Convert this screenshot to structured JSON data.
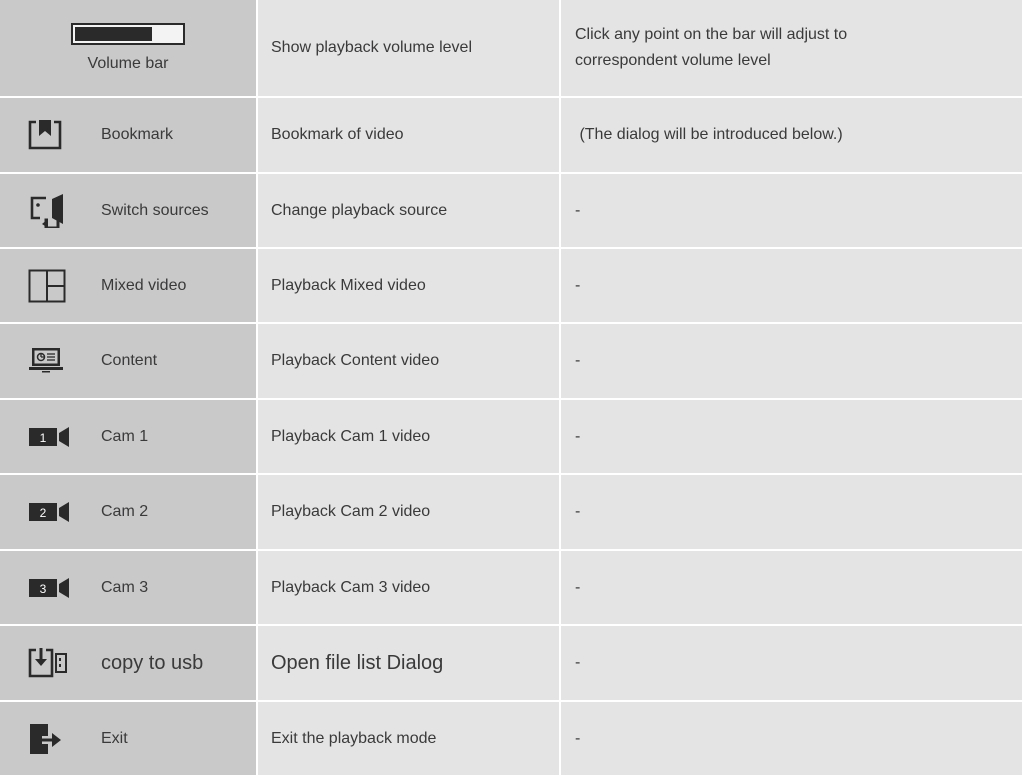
{
  "rows": [
    {
      "label": "Volume bar",
      "description": "Show playback volume level",
      "note": "Click any point on the bar will adjust to correspondent volume level",
      "volume_level": 0.73,
      "icon": "volume-bar-icon"
    },
    {
      "label": "Bookmark",
      "description": "Bookmark of video",
      "note": " (The dialog will be introduced below.)",
      "icon": "bookmark-icon"
    },
    {
      "label": "Switch sources",
      "description": "Change playback source",
      "note": "-",
      "icon": "switch-sources-icon"
    },
    {
      "label": "Mixed video",
      "description": "Playback Mixed video",
      "note": "-",
      "icon": "mixed-video-icon"
    },
    {
      "label": "Content",
      "description": "Playback Content video",
      "note": "-",
      "icon": "content-icon"
    },
    {
      "label": "Cam 1",
      "description": "Playback Cam 1 video",
      "note": "-",
      "icon": "cam-1-icon",
      "cam_number": "1"
    },
    {
      "label": "Cam 2",
      "description": "Playback Cam 2 video",
      "note": "-",
      "icon": "cam-2-icon",
      "cam_number": "2"
    },
    {
      "label": "Cam 3",
      "description": "Playback Cam 3 video",
      "note": "-",
      "icon": "cam-3-icon",
      "cam_number": "3"
    },
    {
      "label": "copy to usb",
      "description": "Open file list Dialog",
      "note": "-",
      "icon": "copy-to-usb-icon"
    },
    {
      "label": "Exit",
      "description": "Exit the playback mode",
      "note": "-",
      "icon": "exit-icon"
    }
  ],
  "colors": {
    "label_cell": "#c9c9ca",
    "content_cell": "#e4e4e5",
    "icon": "#2a2a2a"
  }
}
